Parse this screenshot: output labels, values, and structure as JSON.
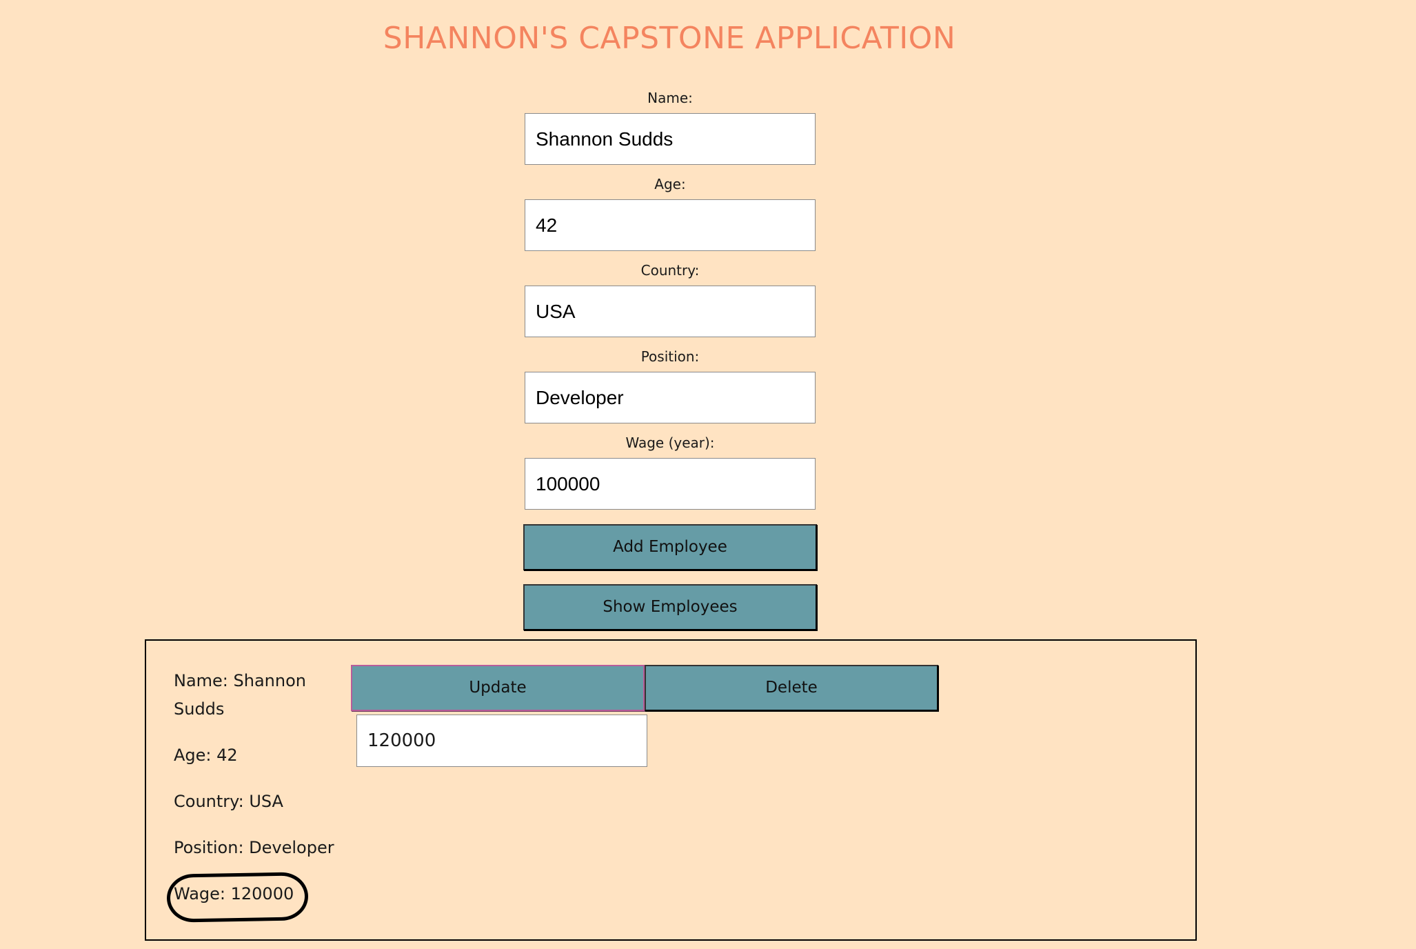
{
  "header": {
    "title": "SHANNON'S CAPSTONE APPLICATION"
  },
  "form": {
    "name_label": "Name:",
    "name_value": "Shannon Sudds",
    "age_label": "Age:",
    "age_value": "42",
    "country_label": "Country:",
    "country_value": "USA",
    "position_label": "Position:",
    "position_value": "Developer",
    "wage_label": "Wage (year):",
    "wage_value": "100000"
  },
  "actions": {
    "add_label": "Add Employee",
    "show_label": "Show Employees"
  },
  "employee": {
    "name_line": "Name: Shannon Sudds",
    "age_line": "Age: 42",
    "country_line": "Country: USA",
    "position_line": "Position: Developer",
    "wage_line": "Wage: 120000",
    "update_label": "Update",
    "delete_label": "Delete",
    "new_wage_value": "120000"
  }
}
